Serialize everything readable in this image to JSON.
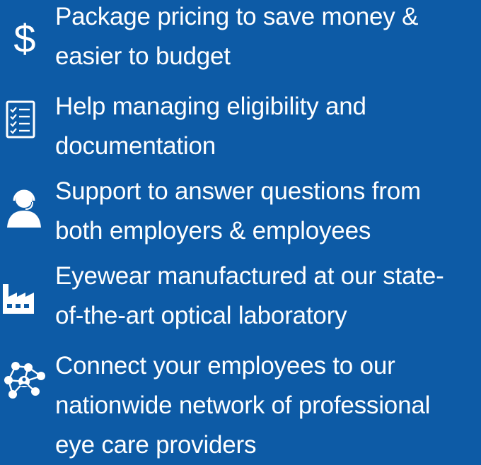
{
  "benefits": [
    {
      "icon": "dollar-sign-icon",
      "lines": [
        "Package pricing to save money &",
        "easier to budget"
      ]
    },
    {
      "icon": "checklist-icon",
      "lines": [
        "Help managing eligibility and",
        "documentation"
      ]
    },
    {
      "icon": "headset-support-icon",
      "lines": [
        "Support to answer questions from",
        "both employers & employees"
      ]
    },
    {
      "icon": "factory-icon",
      "lines": [
        "Eyewear manufactured at our state-",
        "of-the-art optical laboratory"
      ]
    },
    {
      "icon": "people-network-icon",
      "lines": [
        "Connect your employees to our",
        "nationwide network of professional",
        "eye care providers"
      ]
    }
  ],
  "colors": {
    "background": "#0d5ba6",
    "foreground": "#ffffff"
  }
}
